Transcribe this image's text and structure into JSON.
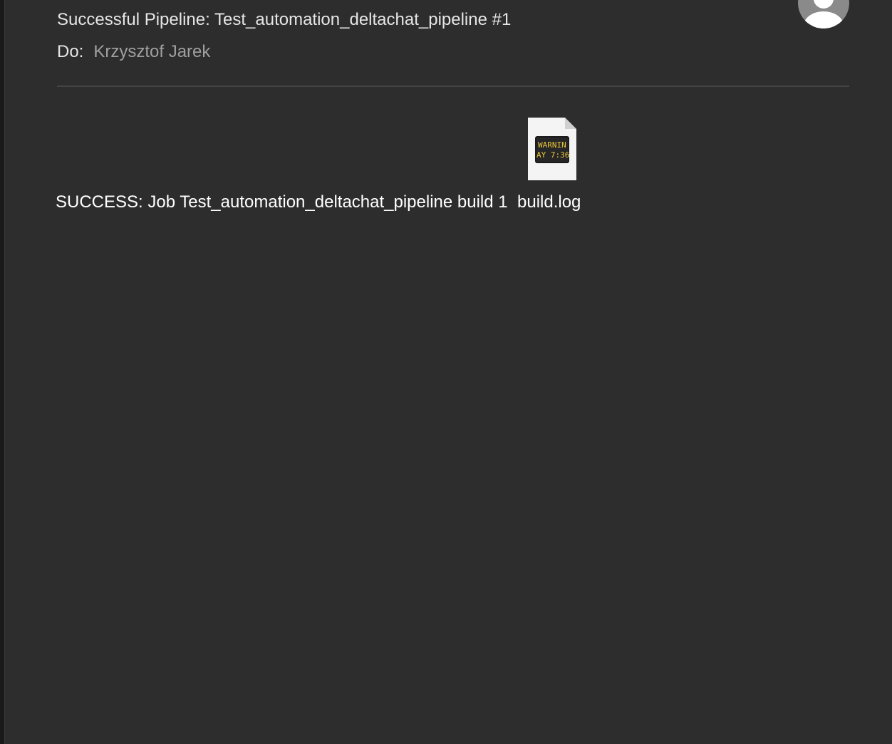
{
  "email": {
    "subject": "Successful Pipeline: Test_automation_deltachat_pipeline #1",
    "to_label": "Do:",
    "to_value": "Krzysztof Jarek",
    "body": "SUCCESS: Job Test_automation_deltachat_pipeline build 1"
  },
  "attachment": {
    "file_name": "build.log",
    "preview_line1": "WARNIN",
    "preview_line2": "AY 7:36",
    "icon": "console-log-file-icon"
  },
  "sender": {
    "avatar_icon": "person-icon"
  },
  "colors": {
    "background": "#2d2d2d",
    "text_primary": "#e6e6e6",
    "text_secondary": "#a0a0a0",
    "preview_text": "#e8c53a"
  }
}
